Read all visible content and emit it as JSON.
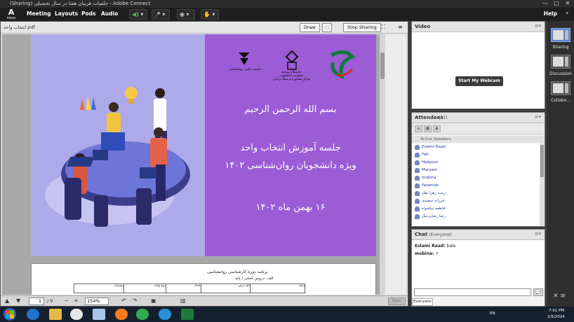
{
  "window": {
    "title": "(Sharing) جلسات هربیان هفتا در سال تحصیلی - Adobe Connect",
    "app_label": "Adobe",
    "min_glyph": "—",
    "max_glyph": "□",
    "close_glyph": "✕"
  },
  "menu": {
    "items": [
      "Meeting",
      "Layouts",
      "Pods",
      "Audio"
    ],
    "help": "Help",
    "help_caret": "▾",
    "speaker_glyph": "◀)",
    "mic_glyph": "🎤",
    "cam_glyph": "◉",
    "raise_glyph": "✋",
    "caret": "▾"
  },
  "share": {
    "filename": "انتخاب واحد.pdf",
    "draw_label": "Draw",
    "stop_label": "Stop Sharing",
    "page_current": "1",
    "page_total": "/ 9",
    "zoom": "154%",
    "sync_label": "Sync",
    "icons": {
      "pointer": "⬚",
      "fullscreen": "⛶",
      "menu": "≡",
      "up": "▲",
      "down": "▼",
      "minus": "−",
      "plus": "+",
      "undo": "↶",
      "redo": "↷",
      "fit": "▣",
      "tree": "▥"
    }
  },
  "doc": {
    "basmala": "بسم الله الرحمن الرحیم",
    "heading1": "جلسه آموزش انتخاب واحد",
    "heading2": "ویژه دانشجویان روان‌شناسی ۱۴۰۲",
    "date_line": "۱۶ بهمن ماه ۱۴۰۲",
    "logo_text_1": "دانشگاه بیرجند\nمعاونت دانشجویی\nمرکز مشاوره و سبک زندگی",
    "logo_text_2": "انجمن علمی روانشناسی",
    "page2_title": "برنامه دوره کارشناسی روانشناسی",
    "page2_subtitle": "الف- دروس اصلی / پایه",
    "page2_cells": [
      "ردیف",
      "نام درس",
      "تعداد",
      "نوع واحد",
      "پیشنیاز"
    ]
  },
  "video": {
    "title": "Video",
    "webcam_button": "Start My Webcam",
    "menu_glyph": "≡▾"
  },
  "attendees": {
    "title": "Attendees",
    "count": "(13)",
    "active_speakers": "Active Speakers",
    "menu_glyph": "≡▾",
    "people": [
      "Eslami Raad",
      "Fati",
      "Hajipour",
      "Maryam",
      "mobina",
      "Yasaman",
      "زینب زهرا نظر",
      "فرزانه سعیدی",
      "فاطمه نیکخواه",
      "رضا رضایی‌نیک"
    ]
  },
  "chat": {
    "title": "Chat",
    "scope": "(Everyone)",
    "messages": [
      {
        "user": "Eslami Raad:",
        "text": "bale"
      },
      {
        "user": "mobina:",
        "text": "+"
      }
    ],
    "tab_label": "Everyone",
    "send_glyph": "💬",
    "menu_glyph": "≡▾"
  },
  "side": {
    "layouts": [
      "Sharing",
      "Discussion",
      "Collabo..."
    ],
    "tools_glyph": "✕ ≡"
  },
  "taskbar": {
    "lang": "EN",
    "time": "7:01 PM",
    "date": "2/5/2024"
  },
  "colors": {
    "slide_left": "#aeaaea",
    "slide_right": "#9b5cd6",
    "accent_blue": "#1b3aa7"
  }
}
